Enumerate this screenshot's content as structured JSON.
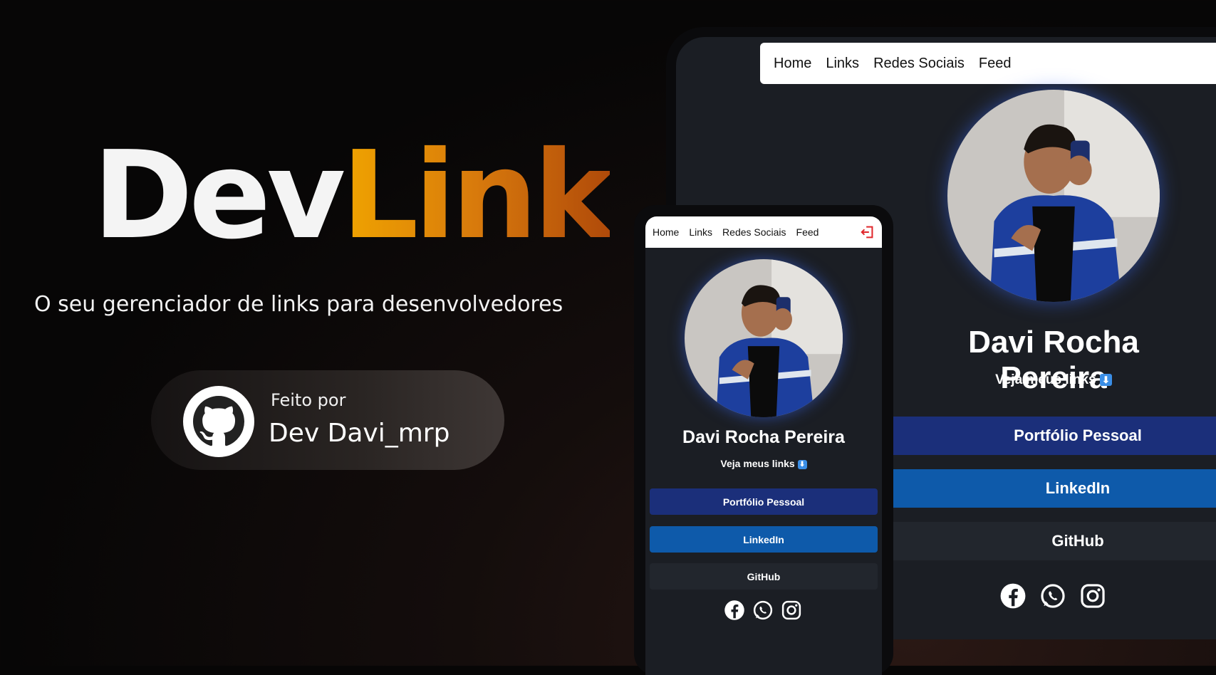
{
  "hero": {
    "brand_part1": "Dev",
    "brand_part2": "Link",
    "tagline": "O seu gerenciador de links para desenvolvedores",
    "badge_small": "Feito por",
    "badge_name": "Dev Davi_mrp"
  },
  "nav": {
    "home": "Home",
    "links": "Links",
    "social": "Redes Sociais",
    "feed": "Feed"
  },
  "profile": {
    "name": "Davi Rocha Pereira",
    "subtitle": "Veja meus links",
    "subtitle_icon": "⬇"
  },
  "links": {
    "portfolio": "Portfólio Pessoal",
    "linkedin": "LinkedIn",
    "github": "GitHub"
  },
  "colors": {
    "portfolio": "#1b2f7a",
    "linkedin": "#0e5aaa",
    "github": "#22262d"
  },
  "icons": [
    "facebook-icon",
    "whatsapp-icon",
    "instagram-icon",
    "github-icon",
    "logout-icon",
    "arrow-down-icon"
  ]
}
